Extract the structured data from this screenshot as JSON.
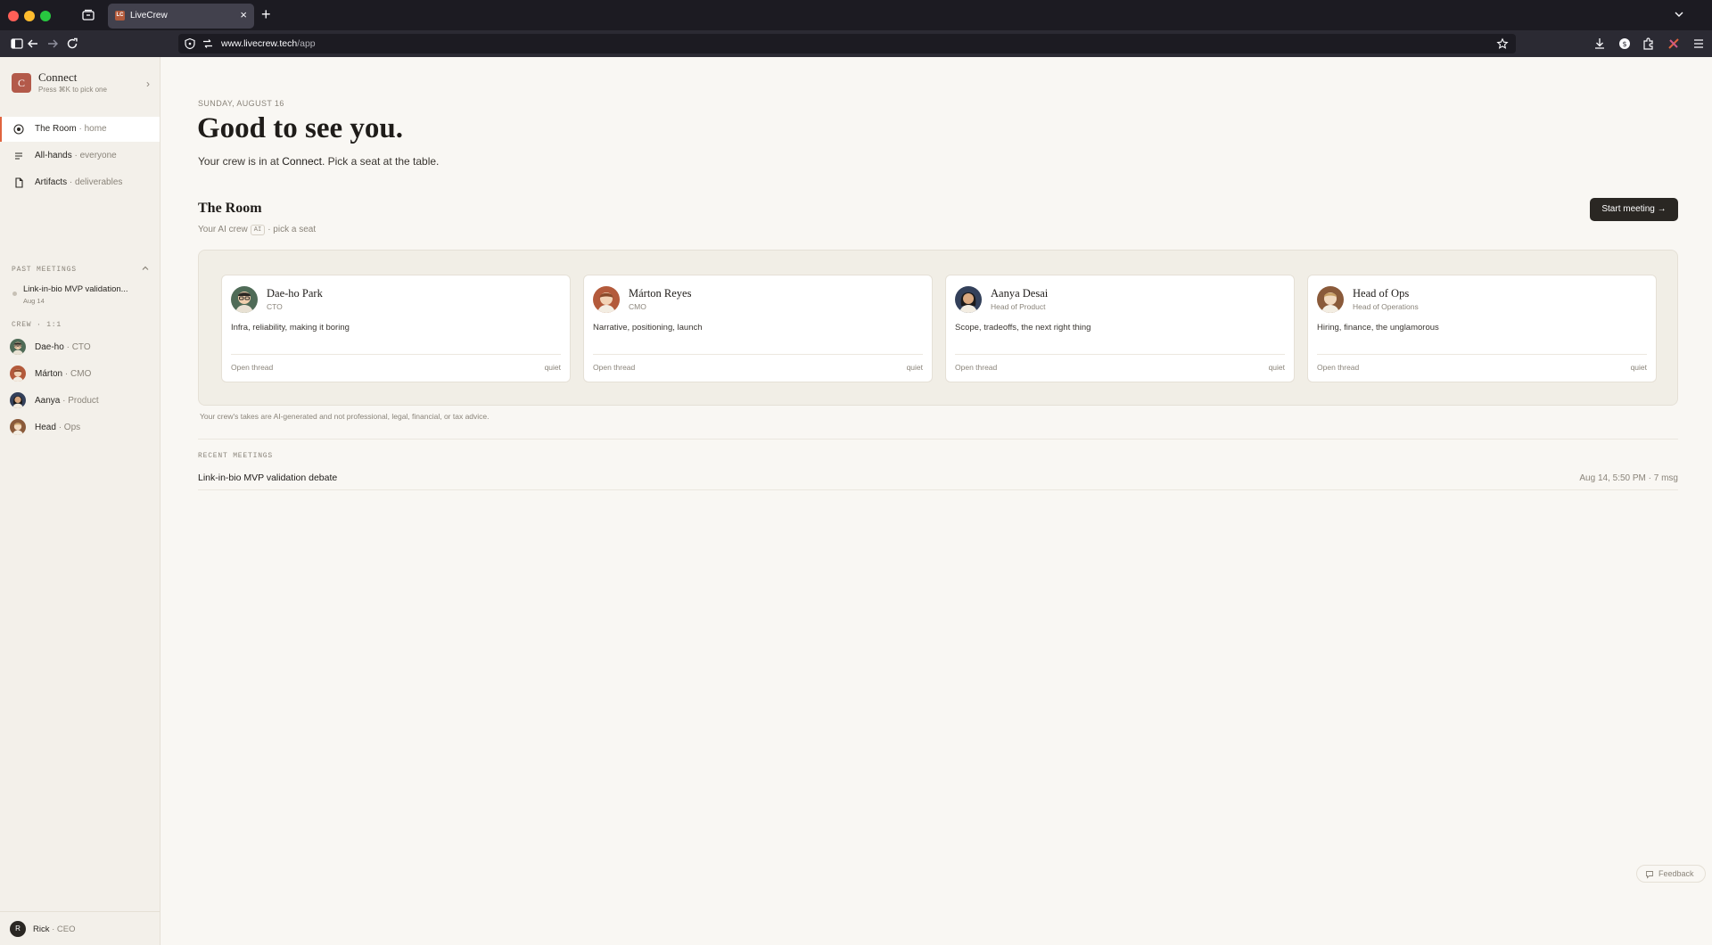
{
  "browser": {
    "tab_title": "LiveCrew",
    "tab_favicon_text": "LC",
    "url_host": "www.livecrew.tech",
    "url_path": "/app"
  },
  "sidebar": {
    "workspace": {
      "logo_letter": "C",
      "name": "Connect",
      "hint": "Press ⌘K to pick one"
    },
    "nav": [
      {
        "label": "The Room",
        "sub": "· home",
        "icon": "target-icon",
        "active": true
      },
      {
        "label": "All-hands",
        "sub": "· everyone",
        "icon": "list-icon",
        "active": false
      },
      {
        "label": "Artifacts",
        "sub": "· deliverables",
        "icon": "document-icon",
        "active": false
      }
    ],
    "past_meetings_heading": "PAST MEETINGS",
    "past_meetings": [
      {
        "title": "Link-in-bio MVP validation...",
        "date": "Aug 14"
      }
    ],
    "crew_heading": "CREW · 1:1",
    "crew": [
      {
        "name": "Dae-ho",
        "role": "· CTO"
      },
      {
        "name": "Márton",
        "role": "· CMO"
      },
      {
        "name": "Aanya",
        "role": "· Product"
      },
      {
        "name": "Head",
        "role": "· Ops"
      }
    ],
    "user": {
      "initial": "R",
      "name": "Rick",
      "role": "· CEO"
    }
  },
  "main": {
    "date": "SUNDAY, AUGUST 16",
    "greeting": "Good to see you.",
    "subline_pre": "Your crew is in at ",
    "subline_workspace": "Connect",
    "subline_post": ". Pick a seat at the table.",
    "room_title": "The Room",
    "room_sub_pre": "Your AI crew",
    "room_sub_tag": "AI",
    "room_sub_post": "· pick a seat",
    "start_button": "Start meeting →",
    "cards": [
      {
        "name": "Dae-ho Park",
        "role": "CTO",
        "desc": "Infra, reliability, making it boring",
        "open": "Open thread",
        "status": "quiet"
      },
      {
        "name": "Márton Reyes",
        "role": "CMO",
        "desc": "Narrative, positioning, launch",
        "open": "Open thread",
        "status": "quiet"
      },
      {
        "name": "Aanya Desai",
        "role": "Head of Product",
        "desc": "Scope, tradeoffs, the next right thing",
        "open": "Open thread",
        "status": "quiet"
      },
      {
        "name": "Head of Ops",
        "role": "Head of Operations",
        "desc": "Hiring, finance, the unglamorous",
        "open": "Open thread",
        "status": "quiet"
      }
    ],
    "disclaimer": "Your crew's takes are AI-generated and not professional, legal, financial, or tax advice.",
    "recent_heading": "RECENT MEETINGS",
    "recent": [
      {
        "title": "Link-in-bio MVP validation debate",
        "meta": "Aug 14, 5:50 PM · 7 msg"
      }
    ],
    "feedback": "Feedback"
  },
  "colors": {
    "accent": "#e0643f",
    "workspace_logo": "#b35a4a",
    "primary_button": "#2a2723",
    "background": "#f9f7f3",
    "sidebar": "#f3f0ea"
  }
}
